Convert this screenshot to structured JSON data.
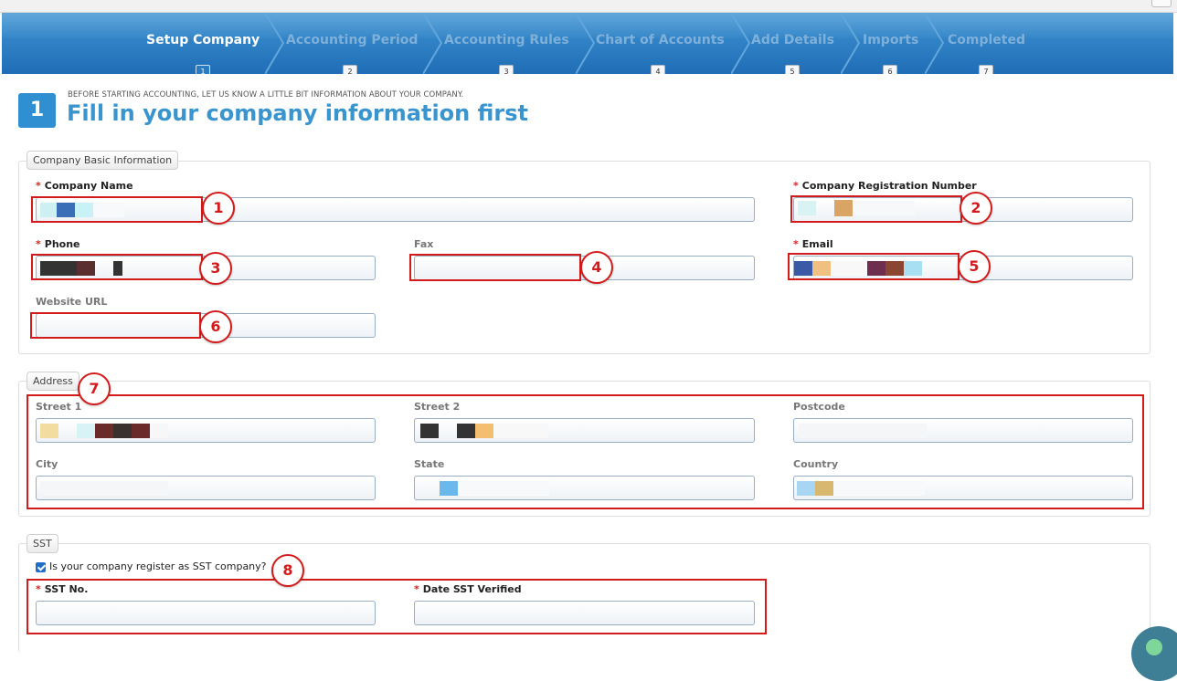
{
  "wizard": {
    "steps": [
      {
        "label": "Setup Company",
        "num": "1"
      },
      {
        "label": "Accounting Period",
        "num": "2"
      },
      {
        "label": "Accounting Rules",
        "num": "3"
      },
      {
        "label": "Chart of Accounts",
        "num": "4"
      },
      {
        "label": "Add Details",
        "num": "5"
      },
      {
        "label": "Imports",
        "num": "6"
      },
      {
        "label": "Completed",
        "num": "7"
      }
    ],
    "active_index": 0
  },
  "header": {
    "step_badge": "1",
    "pre_text": "BEFORE STARTING ACCOUNTING, LET US KNOW A LITTLE BIT INFORMATION ABOUT YOUR COMPANY.",
    "title": "Fill in your company information first"
  },
  "basic_info": {
    "legend": "Company Basic Information",
    "required_mark": "*",
    "company_name": {
      "label": "Company Name",
      "value": ""
    },
    "registration_number": {
      "label": "Company Registration Number",
      "value": ""
    },
    "phone": {
      "label": "Phone",
      "value": ""
    },
    "fax": {
      "label": "Fax",
      "value": ""
    },
    "email": {
      "label": "Email",
      "value": ""
    },
    "website": {
      "label": "Website URL",
      "value": ""
    }
  },
  "address": {
    "legend": "Address",
    "street1": {
      "label": "Street 1",
      "value": ""
    },
    "street2": {
      "label": "Street 2",
      "value": ""
    },
    "postcode": {
      "label": "Postcode",
      "value": ""
    },
    "city": {
      "label": "City",
      "value": ""
    },
    "state": {
      "label": "State",
      "value": ""
    },
    "country": {
      "label": "Country",
      "value": ""
    }
  },
  "sst": {
    "legend": "SST",
    "checkbox_label": "Is your company register as SST company?",
    "checked": true,
    "sst_no": {
      "label": "SST No.",
      "value": ""
    },
    "date_verified": {
      "label": "Date SST Verified",
      "value": ""
    }
  },
  "annotations": [
    "1",
    "2",
    "3",
    "4",
    "5",
    "6",
    "7",
    "8"
  ],
  "colors": {
    "wizard_top": "#3f94d3",
    "wizard_bottom": "#1f6db6",
    "accent": "#2f8fd0",
    "title_blue": "#3a95cf",
    "required": "#d62020",
    "annotation_red": "#d31b1b"
  }
}
